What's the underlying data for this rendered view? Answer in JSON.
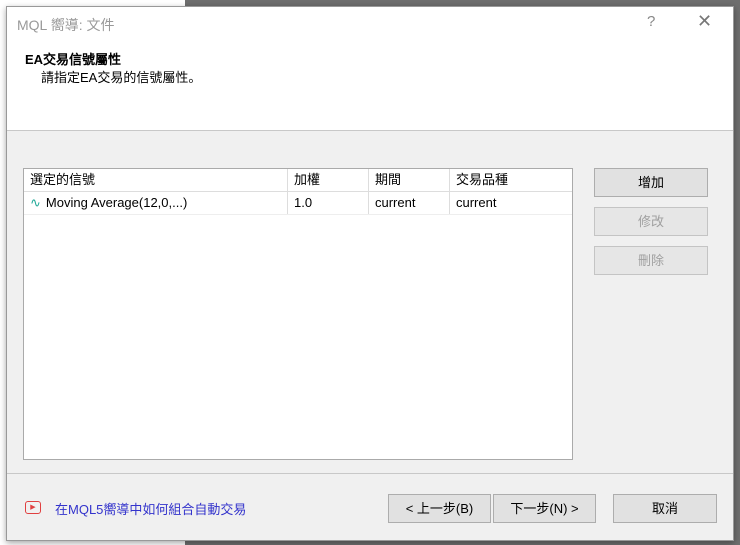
{
  "window": {
    "title": "MQL 嚮導: 文件",
    "help": "?",
    "close": "✕"
  },
  "header": {
    "title": "EA交易信號屬性",
    "subtitle": "請指定EA交易的信號屬性。"
  },
  "table": {
    "columns": [
      "選定的信號",
      "加權",
      "期間",
      "交易品種"
    ],
    "rows": [
      {
        "signal": "Moving Average(12,0,...)",
        "weight": "1.0",
        "period": "current",
        "symbol": "current"
      }
    ]
  },
  "buttons": {
    "add": "增加",
    "edit": "修改",
    "delete": "刪除",
    "back": "< 上一步(B)",
    "next": "下一步(N) >",
    "cancel": "取消"
  },
  "footer": {
    "link": "在MQL5嚮導中如何組合自動交易"
  },
  "colors": {
    "link": "#3333cc",
    "icon": "#e04040"
  }
}
